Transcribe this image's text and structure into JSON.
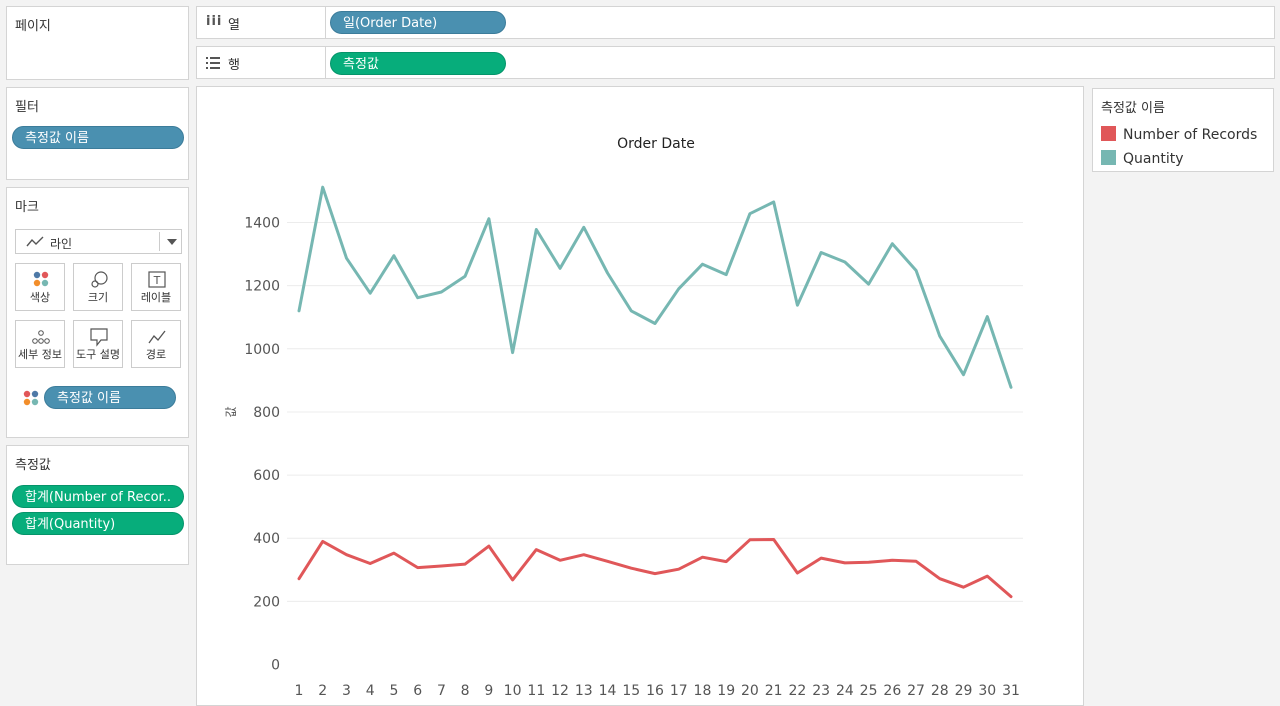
{
  "pages_panel": {
    "title": "페이지"
  },
  "shelves": {
    "columns": {
      "label": "열",
      "pill": "일(Order Date)"
    },
    "rows": {
      "label": "행",
      "pill": "측정값"
    }
  },
  "filters_panel": {
    "title": "필터",
    "pill": "측정값 이름"
  },
  "marks_panel": {
    "title": "마크",
    "mark_type": "라인",
    "buttons": [
      "색상",
      "크기",
      "레이블",
      "세부 정보",
      "도구 설명",
      "경로"
    ],
    "color_pill": "측정값 이름"
  },
  "measure_values_panel": {
    "title": "측정값",
    "pills": [
      "합계(Number of Recor..",
      "합계(Quantity)"
    ]
  },
  "legend": {
    "title": "측정값 이름",
    "items": [
      {
        "label": "Number of Records",
        "color": "#e05759"
      },
      {
        "label": "Quantity",
        "color": "#76b7b2"
      }
    ]
  },
  "chart_data": {
    "type": "line",
    "title": "Order Date",
    "xlabel": "",
    "ylabel": "값",
    "x": [
      "1",
      "2",
      "3",
      "4",
      "5",
      "6",
      "7",
      "8",
      "9",
      "10",
      "11",
      "12",
      "13",
      "14",
      "15",
      "16",
      "17",
      "18",
      "19",
      "20",
      "21",
      "22",
      "23",
      "24",
      "25",
      "26",
      "27",
      "28",
      "29",
      "30",
      "31"
    ],
    "yticks": [
      0,
      200,
      400,
      600,
      800,
      1000,
      1200,
      1400
    ],
    "ylim": [
      -30,
      1560
    ],
    "grid": true,
    "series": [
      {
        "name": "Number of Records",
        "color": "#e05759",
        "values": [
          272,
          390,
          348,
          320,
          353,
          307,
          312,
          318,
          375,
          268,
          364,
          330,
          348,
          327,
          305,
          288,
          302,
          340,
          326,
          395,
          396,
          290,
          337,
          322,
          324,
          330,
          327,
          272,
          245,
          280,
          215
        ]
      },
      {
        "name": "Quantity",
        "color": "#76b7b2",
        "values": [
          1120,
          1512,
          1287,
          1176,
          1295,
          1162,
          1180,
          1230,
          1412,
          988,
          1378,
          1255,
          1385,
          1240,
          1120,
          1080,
          1190,
          1268,
          1235,
          1428,
          1465,
          1138,
          1305,
          1275,
          1205,
          1333,
          1248,
          1040,
          918,
          1102,
          878
        ]
      }
    ]
  }
}
